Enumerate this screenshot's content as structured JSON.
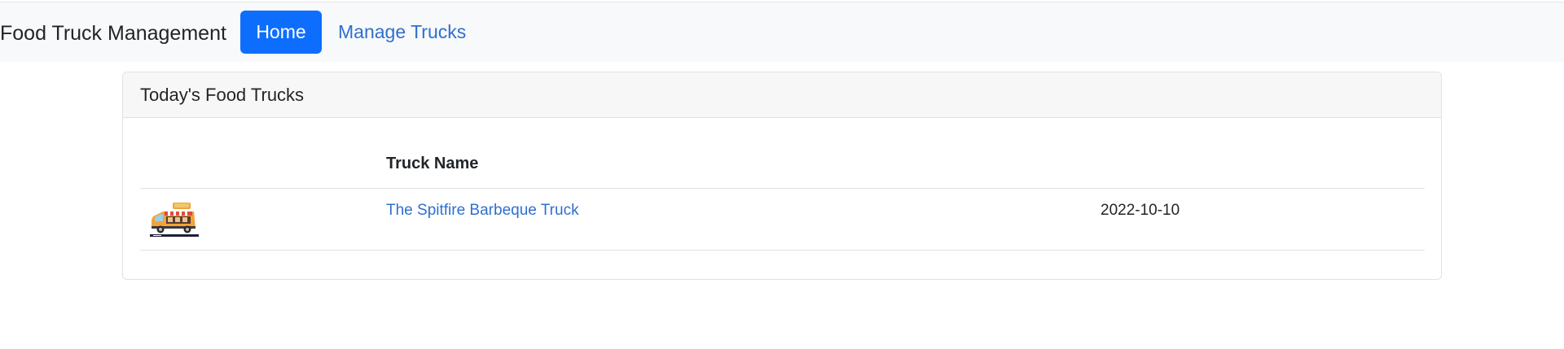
{
  "navbar": {
    "brand": "Food Truck Management",
    "home_label": "Home",
    "manage_label": "Manage Trucks"
  },
  "card": {
    "title": "Today's Food Trucks"
  },
  "table": {
    "columns": [
      "",
      "Truck Name",
      ""
    ],
    "rows": [
      {
        "image_icon": "food-truck-icon",
        "name": "The Spitfire Barbeque Truck",
        "date": "2022-10-10"
      }
    ]
  },
  "colors": {
    "primary": "#0d6efd",
    "link": "#2f6fd0",
    "navbar_bg": "#f8f9fa",
    "card_header_bg": "#f7f7f7"
  }
}
